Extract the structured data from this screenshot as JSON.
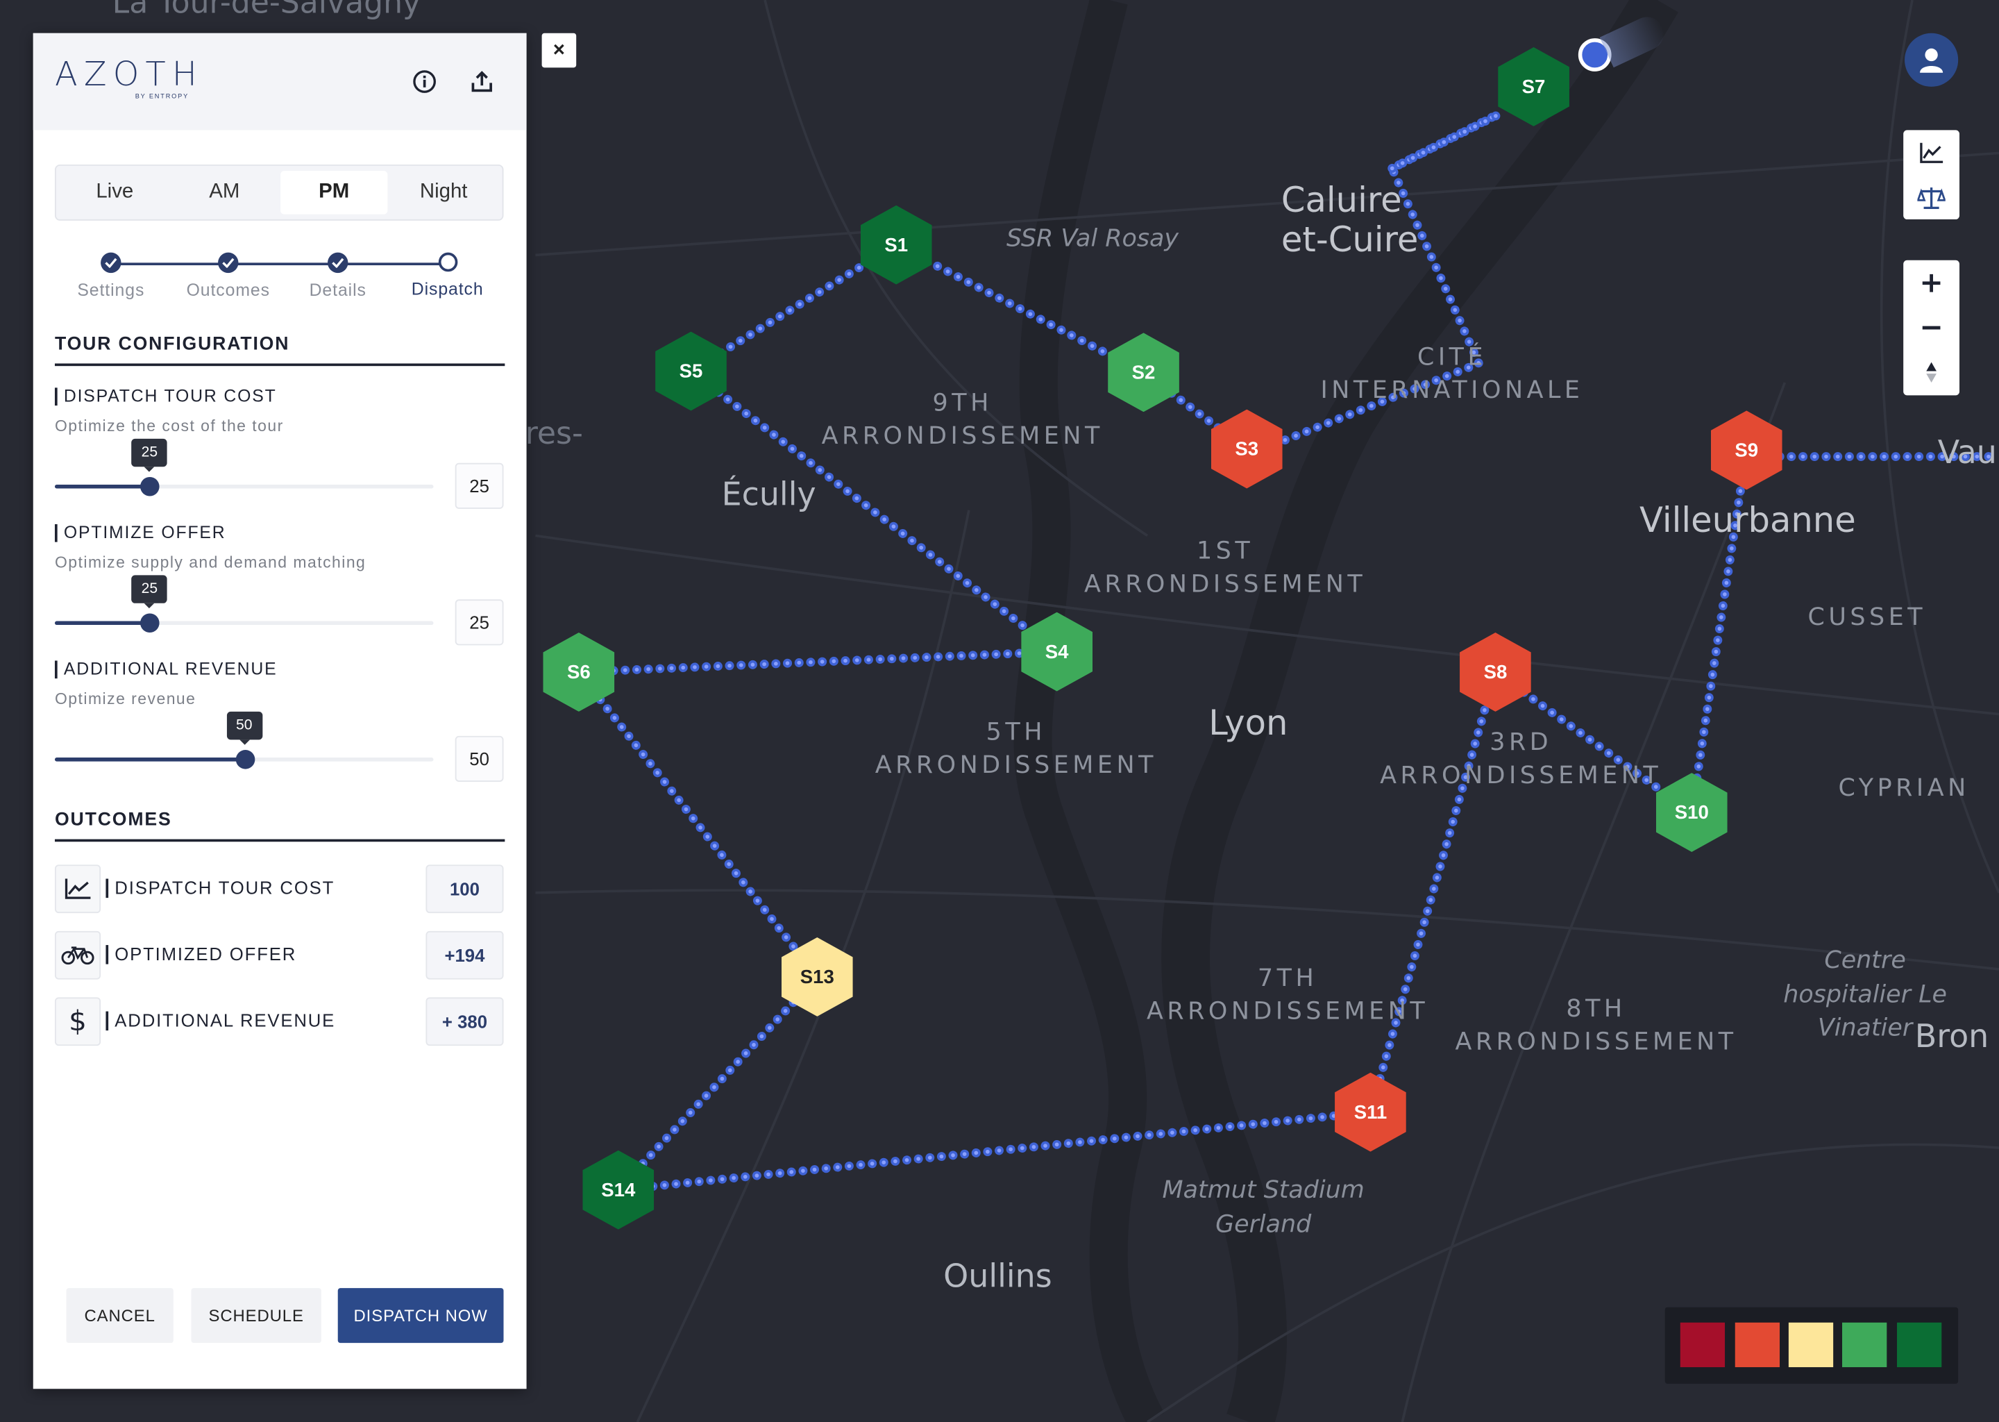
{
  "app": {
    "logo": "AZOTH",
    "logo_sub": "BY ENTROPY",
    "close_label": "×"
  },
  "tabs": [
    {
      "label": "Live",
      "active": false
    },
    {
      "label": "AM",
      "active": false
    },
    {
      "label": "PM",
      "active": true
    },
    {
      "label": "Night",
      "active": false
    }
  ],
  "steps": [
    {
      "label": "Settings",
      "state": "done"
    },
    {
      "label": "Outcomes",
      "state": "done"
    },
    {
      "label": "Details",
      "state": "done"
    },
    {
      "label": "Dispatch",
      "state": "current"
    }
  ],
  "config": {
    "title": "TOUR CONFIGURATION",
    "fields": [
      {
        "title": "DISPATCH TOUR COST",
        "subtitle": "Optimize the cost of the tour",
        "value": 25,
        "max": 100
      },
      {
        "title": "OPTIMIZE OFFER",
        "subtitle": "Optimize supply and demand matching",
        "value": 25,
        "max": 100
      },
      {
        "title": "ADDITIONAL REVENUE",
        "subtitle": "Optimize revenue",
        "value": 50,
        "max": 100
      }
    ]
  },
  "outcomes": {
    "title": "OUTCOMES",
    "rows": [
      {
        "icon": "chart-line-icon",
        "label": "DISPATCH TOUR COST",
        "value": "100"
      },
      {
        "icon": "bicycle-icon",
        "label": "OPTIMIZED OFFER",
        "value": "+194"
      },
      {
        "icon": "dollar-icon",
        "label": "ADDITIONAL REVENUE",
        "value": "+ 380"
      }
    ]
  },
  "actions": {
    "cancel": "CANCEL",
    "schedule": "SCHEDULE",
    "dispatch": "DISPATCH NOW"
  },
  "map": {
    "places": [
      {
        "text": "La Tour-de-Salvagny",
        "cls": "faint"
      },
      {
        "text": "Caluire et-Cuire",
        "cls": "big"
      },
      {
        "text": "SSR Val Rosay",
        "cls": "ital"
      },
      {
        "text": "CITÉ INTERNATIONALE",
        "cls": "arr"
      },
      {
        "text": "9TH ARRONDISSEMENT",
        "cls": "arr"
      },
      {
        "text": "Écully",
        "cls": "mid"
      },
      {
        "text": "Villeurbanne",
        "cls": "big"
      },
      {
        "text": "1ST ARRONDISSEMENT",
        "cls": "arr"
      },
      {
        "text": "CUSSET",
        "cls": "arr"
      },
      {
        "text": "Lyon",
        "cls": "big"
      },
      {
        "text": "5TH ARRONDISSEMENT",
        "cls": "arr"
      },
      {
        "text": "3RD ARRONDISSEMENT",
        "cls": "arr"
      },
      {
        "text": "CYPRIAN",
        "cls": "arr"
      },
      {
        "text": "Centre hospitalier Le Vinatier",
        "cls": "ital"
      },
      {
        "text": "7TH ARRONDISSEMENT",
        "cls": "arr"
      },
      {
        "text": "8TH ARRONDISSEMENT",
        "cls": "arr"
      },
      {
        "text": "Bron",
        "cls": "mid"
      },
      {
        "text": "Matmut Stadium Gerland",
        "cls": "ital"
      },
      {
        "text": "Oullins",
        "cls": "mid"
      },
      {
        "text": "res-",
        "cls": "faint"
      },
      {
        "text": "Vau",
        "cls": "mid"
      }
    ],
    "stations": [
      {
        "id": "S1",
        "status": "dark-green"
      },
      {
        "id": "S2",
        "status": "green"
      },
      {
        "id": "S3",
        "status": "red"
      },
      {
        "id": "S4",
        "status": "green"
      },
      {
        "id": "S5",
        "status": "dark-green"
      },
      {
        "id": "S6",
        "status": "green"
      },
      {
        "id": "S7",
        "status": "dark-green"
      },
      {
        "id": "S8",
        "status": "red"
      },
      {
        "id": "S9",
        "status": "red"
      },
      {
        "id": "S10",
        "status": "green"
      },
      {
        "id": "S11",
        "status": "red"
      },
      {
        "id": "S13",
        "status": "yellow"
      },
      {
        "id": "S14",
        "status": "dark-green"
      }
    ]
  },
  "colors": {
    "accent": "#2c4a8a",
    "route": "#3f63d6",
    "dark-red": "#a50f2a",
    "red": "#e34a33",
    "yellow": "#fde69a",
    "green": "#3eaa5a",
    "dark-green": "#0b6e34"
  },
  "legend": [
    "dark-red",
    "red",
    "yellow",
    "green",
    "dark-green"
  ]
}
